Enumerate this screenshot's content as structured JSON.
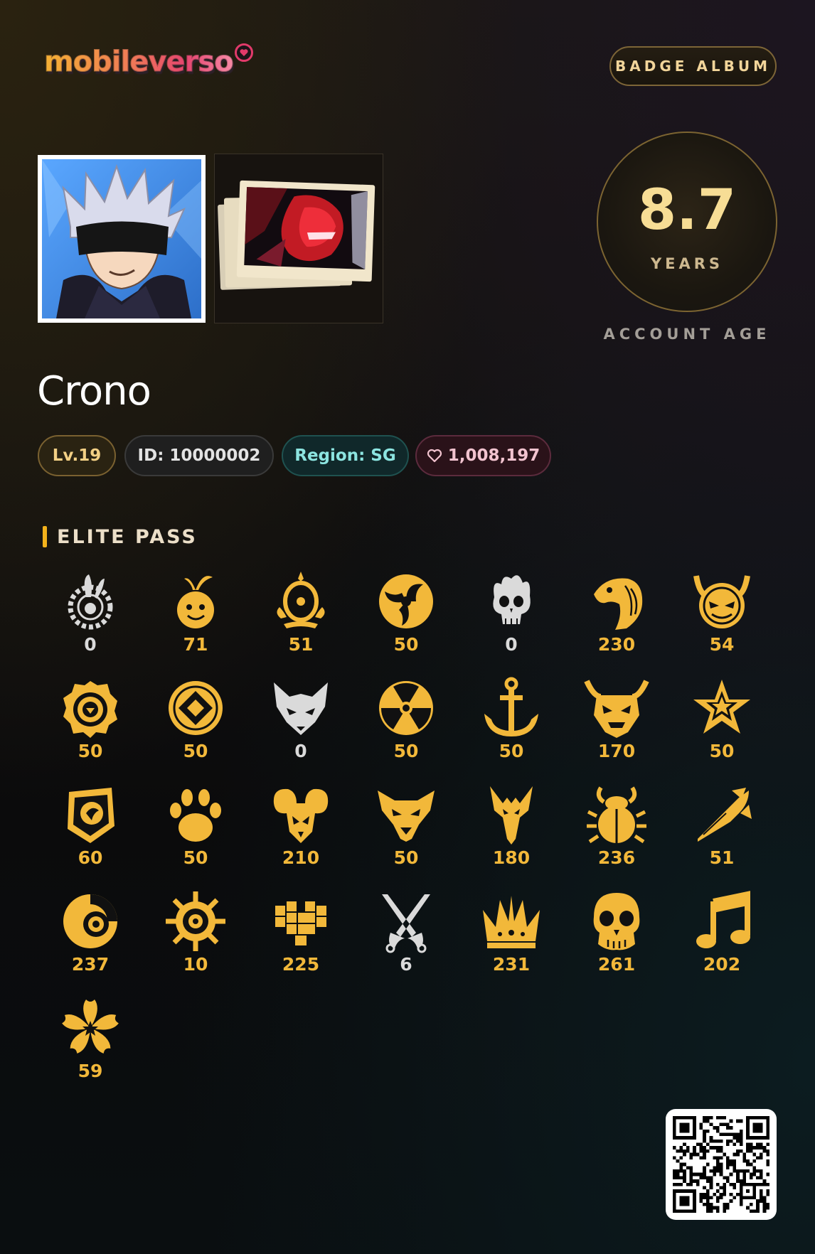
{
  "header": {
    "logo_text": "mobileverso",
    "badge_album_label": "BADGE ALBUM"
  },
  "account_age": {
    "value": "8.7",
    "unit": "YEARS",
    "caption": "ACCOUNT AGE"
  },
  "profile": {
    "name": "Crono",
    "level": "Lv.19",
    "id": "ID: 10000002",
    "region": "Region: SG",
    "likes": "1,008,197"
  },
  "elite_pass": {
    "title": "ELITE PASS",
    "badges": [
      {
        "icon": "rabbit-gear-icon",
        "count": "0",
        "owned": false
      },
      {
        "icon": "pineapple-icon",
        "count": "71",
        "owned": true
      },
      {
        "icon": "ornate-ring-icon",
        "count": "51",
        "owned": true
      },
      {
        "icon": "tomoe-swirl-icon",
        "count": "50",
        "owned": true
      },
      {
        "icon": "flaming-skull-icon",
        "count": "0",
        "owned": false
      },
      {
        "icon": "eagle-head-icon",
        "count": "230",
        "owned": true
      },
      {
        "icon": "devil-face-icon",
        "count": "54",
        "owned": true
      },
      {
        "icon": "target-gear-icon",
        "count": "50",
        "owned": true
      },
      {
        "icon": "coin-diamond-icon",
        "count": "50",
        "owned": true
      },
      {
        "icon": "fox-head-icon",
        "count": "0",
        "owned": false
      },
      {
        "icon": "radiation-icon",
        "count": "50",
        "owned": true
      },
      {
        "icon": "anchor-icon",
        "count": "50",
        "owned": true
      },
      {
        "icon": "demon-mask-icon",
        "count": "170",
        "owned": true
      },
      {
        "icon": "sheriff-star-icon",
        "count": "50",
        "owned": true
      },
      {
        "icon": "shield-emblem-icon",
        "count": "60",
        "owned": true
      },
      {
        "icon": "paw-icon",
        "count": "50",
        "owned": true
      },
      {
        "icon": "ram-skull-icon",
        "count": "210",
        "owned": true
      },
      {
        "icon": "wolf-head-icon",
        "count": "50",
        "owned": true
      },
      {
        "icon": "dragon-head-icon",
        "count": "180",
        "owned": true
      },
      {
        "icon": "scarab-beetle-icon",
        "count": "236",
        "owned": true
      },
      {
        "icon": "missile-icon",
        "count": "51",
        "owned": true
      },
      {
        "icon": "eye-orb-icon",
        "count": "237",
        "owned": true
      },
      {
        "icon": "sun-gear-icon",
        "count": "10",
        "owned": true
      },
      {
        "icon": "pixel-heart-icon",
        "count": "225",
        "owned": true
      },
      {
        "icon": "crossed-swords-icon",
        "count": "6",
        "owned": false
      },
      {
        "icon": "crown-icon",
        "count": "231",
        "owned": true
      },
      {
        "icon": "skull-icon",
        "count": "261",
        "owned": true
      },
      {
        "icon": "music-note-icon",
        "count": "202",
        "owned": true
      },
      {
        "icon": "sakura-flower-icon",
        "count": "59",
        "owned": true
      }
    ]
  },
  "colors": {
    "gold": "#f2b83a",
    "muted": "#dadada",
    "accent": "#f3b21b"
  }
}
